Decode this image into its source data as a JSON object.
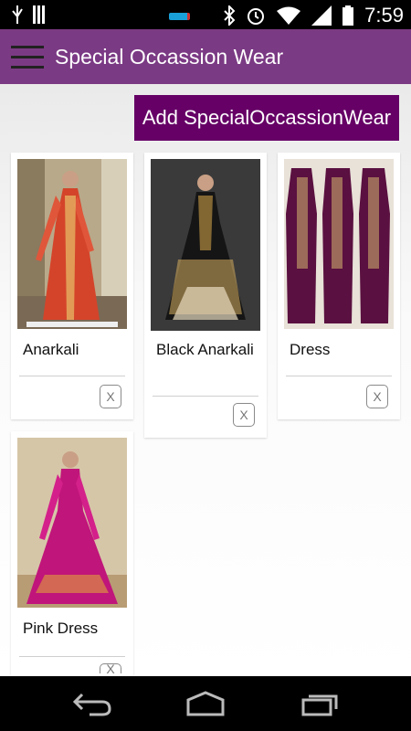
{
  "status_bar": {
    "time": "7:59",
    "icons": [
      "usb-icon",
      "signal-bars-icon",
      "bluetooth-icon",
      "alarm-icon",
      "wifi-icon",
      "cell-signal-icon",
      "battery-icon"
    ]
  },
  "app_bar": {
    "title": "Special Occassion Wear",
    "menu_icon": "hamburger-icon",
    "color": "#7b3a84"
  },
  "add_button": {
    "label": "Add SpecialOccassionWear",
    "color": "#660066"
  },
  "items": [
    {
      "name": "Anarkali",
      "delete_label": "X",
      "image": "red anarkali dress photo"
    },
    {
      "name": "Black Anarkali",
      "delete_label": "X",
      "image": "black anarkali dress photo"
    },
    {
      "name": "Dress",
      "delete_label": "X",
      "image": "three purple dresses photo"
    },
    {
      "name": "Pink Dress",
      "delete_label": "X",
      "image": "pink lehenga dress photo"
    }
  ],
  "nav_bar": {
    "icons": [
      "back-icon",
      "home-icon",
      "recent-apps-icon"
    ]
  }
}
